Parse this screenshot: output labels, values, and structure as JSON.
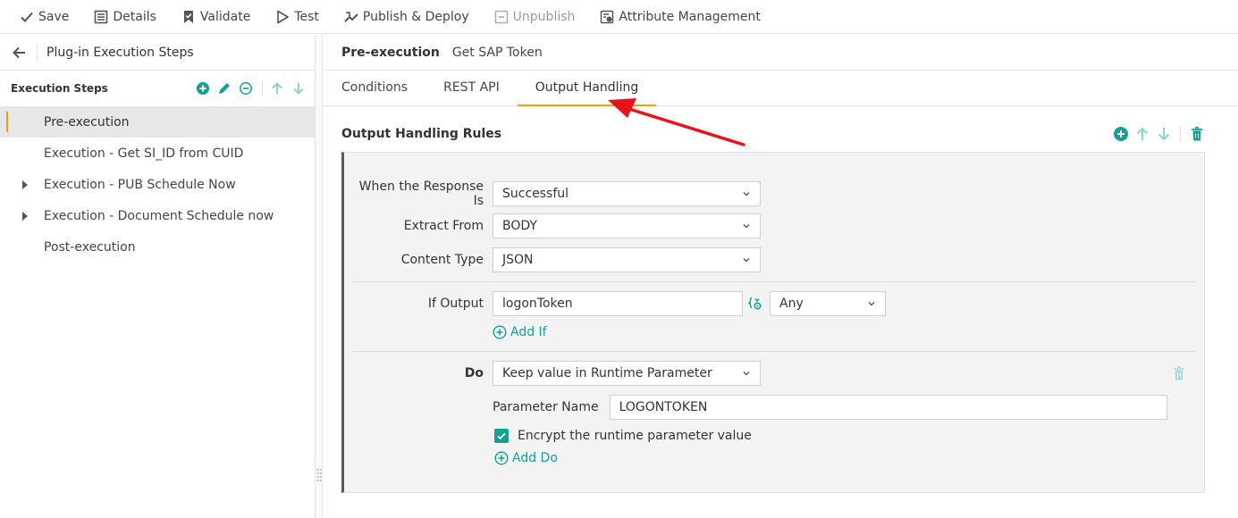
{
  "toolbar": {
    "save": "Save",
    "details": "Details",
    "validate": "Validate",
    "test": "Test",
    "publish": "Publish & Deploy",
    "unpublish": "Unpublish",
    "attribute": "Attribute Management"
  },
  "left": {
    "title": "Plug-in Execution Steps",
    "steps_header": "Execution Steps",
    "steps": [
      {
        "label": "Pre-execution"
      },
      {
        "label": "Execution - Get SI_ID from CUID"
      },
      {
        "label": "Execution - PUB Schedule Now"
      },
      {
        "label": "Execution - Document Schedule now"
      },
      {
        "label": "Post-execution"
      }
    ]
  },
  "right": {
    "step_kind": "Pre-execution",
    "step_name": "Get SAP Token",
    "tabs": [
      "Conditions",
      "REST API",
      "Output Handling"
    ],
    "rules_title": "Output Handling Rules",
    "rule": {
      "response_label": "When the Response Is",
      "response_value": "Successful",
      "extract_label": "Extract From",
      "extract_value": "BODY",
      "content_label": "Content Type",
      "content_value": "JSON",
      "if_label": "If Output",
      "if_value": "logonToken",
      "if_match": "Any",
      "add_if": "Add If",
      "do_label": "Do",
      "do_value": "Keep value in Runtime Parameter",
      "param_label": "Parameter Name",
      "param_value": "LOGONTOKEN",
      "encrypt_label": "Encrypt the runtime parameter value",
      "add_do": "Add Do"
    }
  },
  "colors": {
    "accent_teal": "#14a093",
    "tab_underline": "#f0a300",
    "annotation_red": "#e8141b"
  }
}
